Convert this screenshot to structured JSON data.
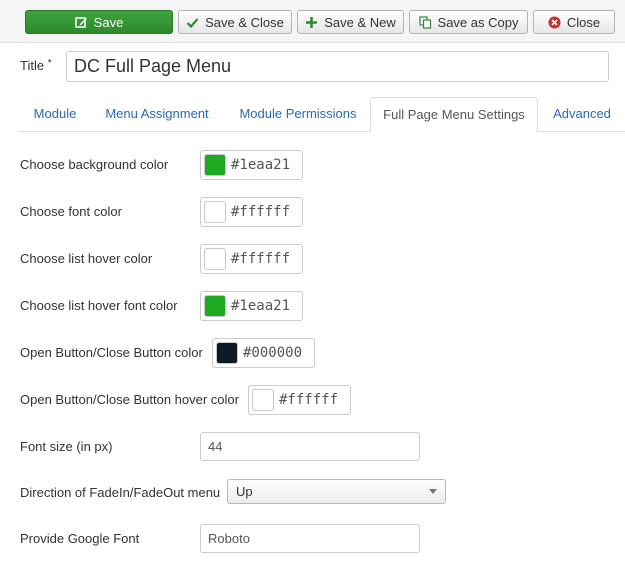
{
  "toolbar": {
    "save": "Save",
    "save_close": "Save & Close",
    "save_new": "Save & New",
    "save_copy": "Save as Copy",
    "close": "Close"
  },
  "title": {
    "label": "Title",
    "required_mark": "*",
    "value": "DC Full Page Menu"
  },
  "tabs": [
    "Module",
    "Menu Assignment",
    "Module Permissions",
    "Full Page Menu Settings",
    "Advanced"
  ],
  "active_tab": "Full Page Menu Settings",
  "fields": {
    "bg_color": {
      "label": "Choose background color",
      "value": "#1eaa21",
      "swatch": "#1eaa21"
    },
    "font_color": {
      "label": "Choose font color",
      "value": "#ffffff",
      "swatch": "#ffffff"
    },
    "hover_color": {
      "label": "Choose list hover color",
      "value": "#ffffff",
      "swatch": "#ffffff"
    },
    "hover_font_color": {
      "label": "Choose list hover font color",
      "value": "#1eaa21",
      "swatch": "#1eaa21"
    },
    "btn_color": {
      "label": "Open Button/Close Button color",
      "value": "#000000",
      "swatch": "#0d1a2a"
    },
    "btn_hover_color": {
      "label": "Open Button/Close Button hover color",
      "value": "#ffffff",
      "swatch": "#ffffff"
    },
    "font_size": {
      "label": "Font size (in px)",
      "value": "44"
    },
    "direction": {
      "label": "Direction of FadeIn/FadeOut menu",
      "value": "Up"
    },
    "google_font": {
      "label": "Provide Google Font",
      "value": "Roboto"
    }
  },
  "colors": {
    "save_green": "#2d8a2d",
    "link_blue": "#2a69b8",
    "close_red": "#c9302c"
  }
}
